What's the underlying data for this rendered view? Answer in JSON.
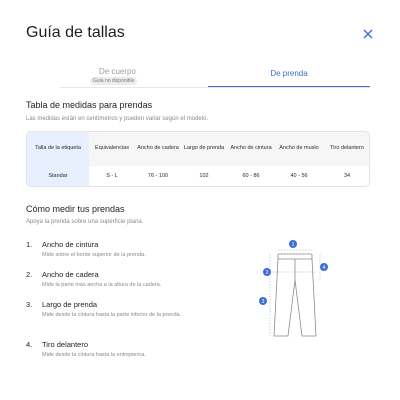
{
  "header": {
    "title": "Guía de tallas",
    "close_icon": "close-icon"
  },
  "tabs": [
    {
      "label": "De cuerpo",
      "badge": "Guia no disponible",
      "active": false
    },
    {
      "label": "De prenda",
      "active": true
    }
  ],
  "table_section": {
    "title": "Tabla de medidas para prendas",
    "note": "Las medidas están en centímetros y pueden variar según el modelo.",
    "headers": [
      "Talla de la etiqueta",
      "Equivalencias",
      "Ancho de cadera",
      "Largo de prenda",
      "Ancho de cintura",
      "Ancho de muslo",
      "Tiro delantero"
    ],
    "rows": [
      [
        "Standar",
        "S - L",
        "76 - 100",
        "102",
        "60 - 86",
        "40 - 56",
        "34"
      ]
    ]
  },
  "steps_section": {
    "title": "Cómo medir tus prendas",
    "intro": "Apoya la prenda sobre una superficie plana.",
    "steps": [
      {
        "num": "1.",
        "name": "Ancho de cintura",
        "desc": "Mide sobre el borde superior de la prenda."
      },
      {
        "num": "2.",
        "name": "Ancho de cadera",
        "desc": "Mide la parte más ancha a la altura de la cadera."
      },
      {
        "num": "3.",
        "name": "Largo de prenda",
        "desc": "Mide desde la cintura hasta la parte inferior de la prenda."
      },
      {
        "num": "4.",
        "name": "Tiro delantero",
        "desc": "Mide desde la cintura hasta la entrepierna."
      }
    ]
  },
  "diagram": {
    "markers": [
      "1",
      "2",
      "3",
      "4"
    ],
    "accent_color": "#3b6fd4"
  }
}
